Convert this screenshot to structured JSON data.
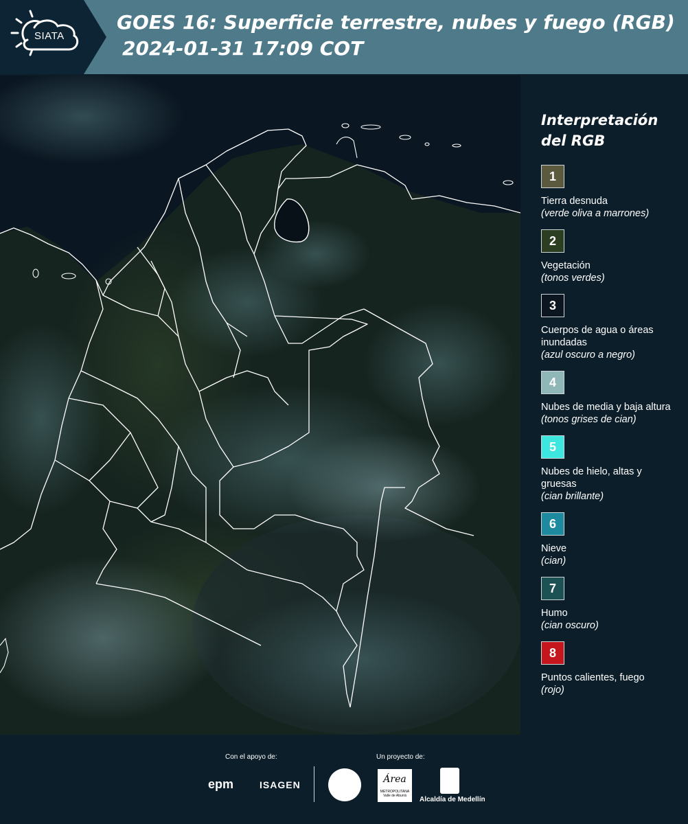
{
  "header": {
    "logo_text": "SIATA",
    "title_line1": "GOES 16: Superficie terrestre, nubes y fuego (RGB)",
    "title_line2": "2024-01-31 17:09 COT",
    "background_color": "#4f7a89"
  },
  "map": {
    "background_color": "#0a1621",
    "border_color": "#ffffff"
  },
  "legend": {
    "title_line1": "Interpretación",
    "title_line2": "del RGB",
    "items": [
      {
        "number": "1",
        "color": "#5b5a3f",
        "label": "Tierra desnuda",
        "desc": "(verde oliva a marrones)"
      },
      {
        "number": "2",
        "color": "#2c3e22",
        "label": "Vegetación",
        "desc": "(tonos verdes)"
      },
      {
        "number": "3",
        "color": "#0b1620",
        "label": "Cuerpos de agua o áreas inundadas",
        "desc": "(azul oscuro a negro)"
      },
      {
        "number": "4",
        "color": "#8fb7b8",
        "label": "Nubes de media y baja altura",
        "desc": "(tonos grises de cian)"
      },
      {
        "number": "5",
        "color": "#3ee6e0",
        "label": "Nubes de hielo, altas y gruesas",
        "desc": "(cian brillante)"
      },
      {
        "number": "6",
        "color": "#1e8aa0",
        "label": "Nieve",
        "desc": "(cian)"
      },
      {
        "number": "7",
        "color": "#1d5254",
        "label": "Humo",
        "desc": "(cian oscuro)"
      },
      {
        "number": "8",
        "color": "#c4161c",
        "label": "Puntos calientes, fuego",
        "desc": "(rojo)"
      }
    ]
  },
  "footer": {
    "support_label": "Con el apoyo de:",
    "project_label": "Un proyecto de:",
    "sponsor_1": "epm",
    "sponsor_2": "ISAGEN",
    "partner_metro": "Área",
    "partner_metro_sub": "METROPOLITANA Valle de Aburrá",
    "partner_alcaldia": "Alcaldía de Medellín"
  }
}
